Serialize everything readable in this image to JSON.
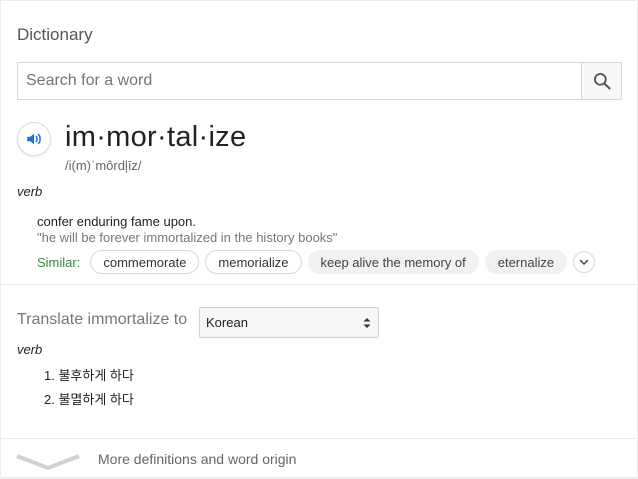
{
  "header": {
    "title": "Dictionary"
  },
  "search": {
    "placeholder": "Search for a word"
  },
  "entry": {
    "headword": "im·mor·tal·ize",
    "phonetic": "/i(m)ˈmôrdl̩īz/",
    "pos": "verb",
    "definition": "confer enduring fame upon.",
    "example": "\"he will be forever immortalized in the history books\"",
    "similar_label": "Similar:",
    "similar": [
      "commemorate",
      "memorialize",
      "keep alive the memory of",
      "eternalize"
    ]
  },
  "translate": {
    "label": "Translate immortalize to",
    "language": "Korean",
    "pos": "verb",
    "items": [
      "1. 불후하게 하다",
      "2. 불멸하게 하다"
    ]
  },
  "footer": {
    "more_label": "More definitions and word origin"
  },
  "colors": {
    "similar_label": "#3a8a3a",
    "speaker_icon": "#1a73e8"
  },
  "icons": [
    "search-icon",
    "speaker-icon",
    "chevron-down-icon",
    "select-arrows-icon",
    "chevron-down-large-icon"
  ]
}
